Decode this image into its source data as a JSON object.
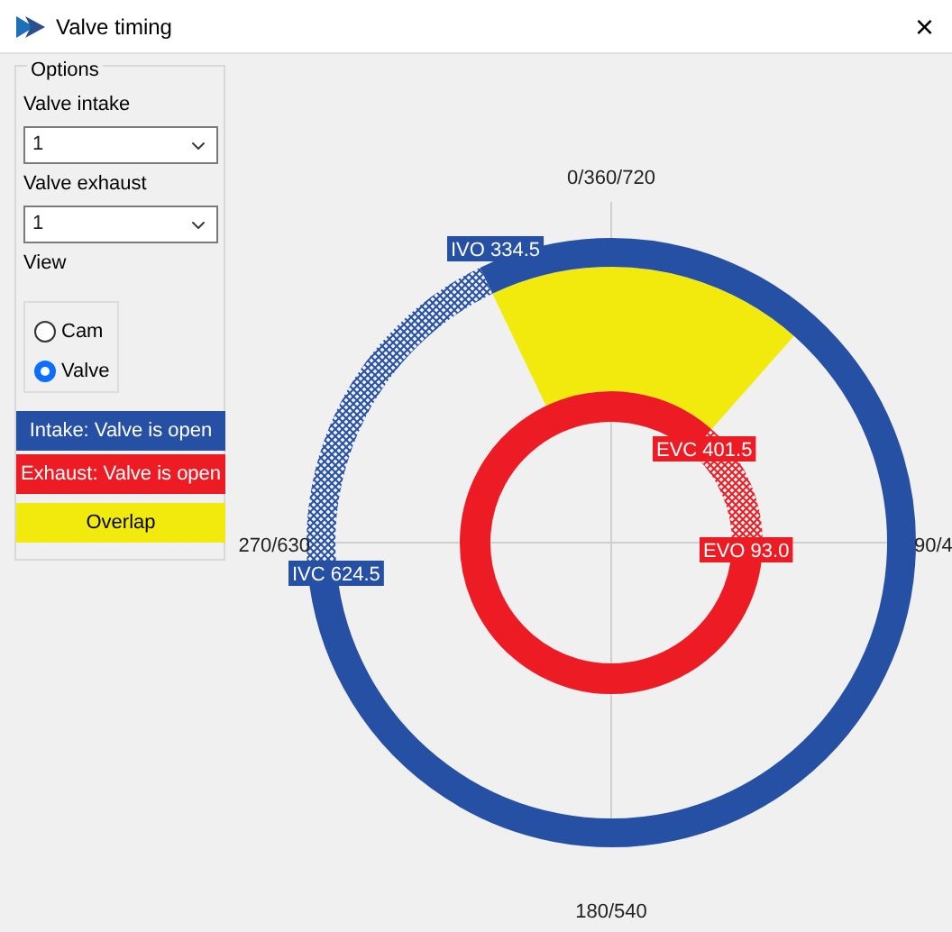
{
  "window": {
    "title": "Valve timing",
    "close": "×"
  },
  "options": {
    "title": "Options",
    "fields": [
      {
        "label": "Valve intake",
        "value": "1"
      },
      {
        "label": "Valve exhaust",
        "value": "1"
      }
    ],
    "view": {
      "label": "View",
      "choices": [
        {
          "label": "Cam",
          "selected": false
        },
        {
          "label": "Valve",
          "selected": true
        }
      ]
    }
  },
  "legend": [
    {
      "label": "Intake: Valve is open",
      "color": "#2550a3"
    },
    {
      "label": "Exhaust: Valve is open",
      "color": "#ed1c24"
    },
    {
      "label": "Overlap",
      "color": "#f2ea0c"
    }
  ],
  "diagram": {
    "axis_labels": [
      "0/360/720",
      "90/4",
      "180/540",
      "270/630"
    ],
    "markers": [
      {
        "label": "IVO 334.5",
        "kind": "intake"
      },
      {
        "label": "IVC 624.5",
        "kind": "intake"
      },
      {
        "label": "EVC 401.5",
        "kind": "exhaust"
      },
      {
        "label": "EVO 93.0",
        "kind": "exhaust"
      }
    ]
  }
}
